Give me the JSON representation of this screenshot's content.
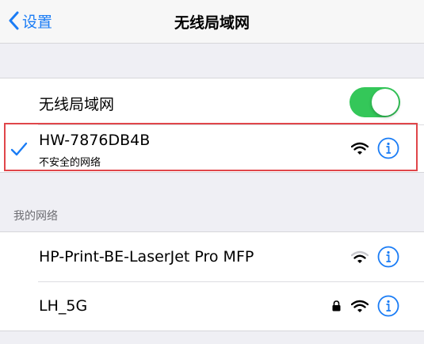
{
  "nav": {
    "back_label": "设置",
    "title": "无线局域网"
  },
  "wifi_toggle": {
    "label": "无线局域网",
    "on": true
  },
  "current_network": {
    "name": "HW-7876DB4B",
    "subtitle": "不安全的网络",
    "connected": true,
    "signal": "full",
    "locked": false
  },
  "my_networks": {
    "header": "我的网络",
    "items": [
      {
        "name": "HP-Print-BE-LaserJet Pro MFP",
        "signal": "partial",
        "locked": false
      },
      {
        "name": "LH_5G",
        "signal": "full",
        "locked": true
      }
    ]
  },
  "colors": {
    "accent": "#1a7cf5",
    "toggle_on": "#34c759",
    "highlight": "#e0464a",
    "background": "#efeff4"
  },
  "icons": [
    "chevron-left-icon",
    "checkmark-icon",
    "wifi-icon",
    "info-icon",
    "lock-icon"
  ]
}
